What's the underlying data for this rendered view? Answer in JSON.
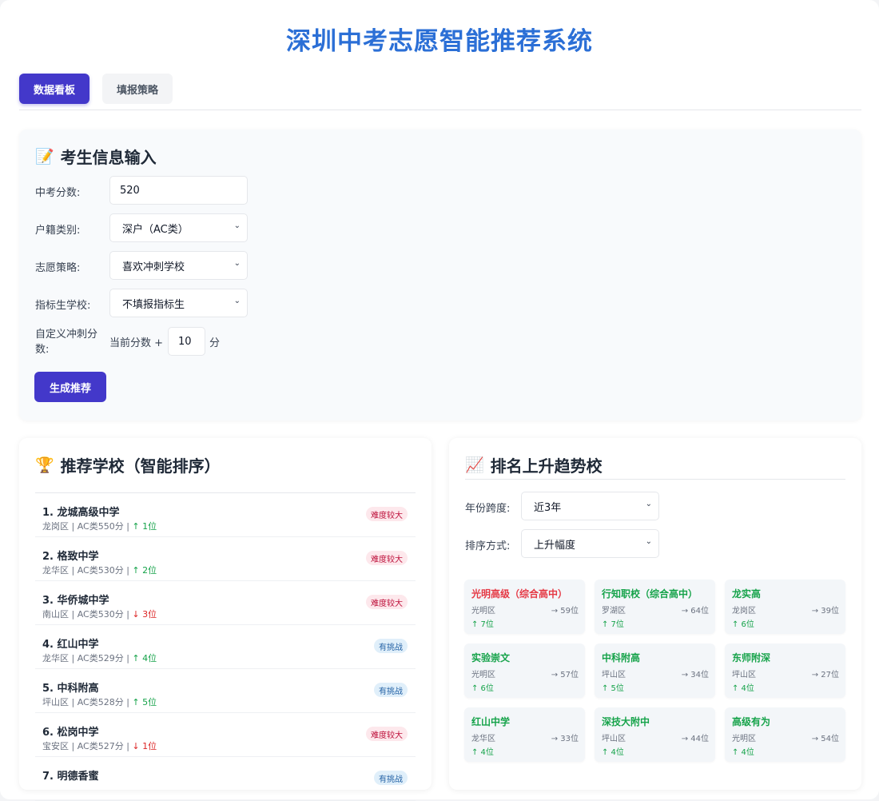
{
  "app": {
    "title": "深圳中考志愿智能推荐系统"
  },
  "tabs": [
    {
      "label": "数据看板",
      "active": true
    },
    {
      "label": "填报策略",
      "active": false
    }
  ],
  "student_form": {
    "title": "考生信息输入",
    "title_icon": "memo-icon",
    "fields": {
      "score": {
        "label": "中考分数:",
        "value": "520"
      },
      "hukou": {
        "label": "户籍类别:",
        "value": "深户（AC类）"
      },
      "strategy": {
        "label": "志愿策略:",
        "value": "喜欢冲刺学校"
      },
      "quota": {
        "label": "指标生学校:",
        "value": "不填报指标生"
      },
      "bonus": {
        "label": "自定义冲刺分数:",
        "prefix": "当前分数 +",
        "value": "10",
        "suffix": "分"
      }
    },
    "submit_label": "生成推荐"
  },
  "recommendations": {
    "title": "推荐学校（智能排序）",
    "title_icon": "trophy-icon",
    "items": [
      {
        "name": "1. 龙城高级中学",
        "meta": "龙岗区 | AC类550分 |",
        "change": "↑ 1位",
        "direction": "up",
        "badge": "难度较大",
        "badge_type": "hard"
      },
      {
        "name": "2. 格致中学",
        "meta": "龙华区 | AC类530分 |",
        "change": "↑ 2位",
        "direction": "up",
        "badge": "难度较大",
        "badge_type": "hard"
      },
      {
        "name": "3. 华侨城中学",
        "meta": "南山区 | AC类530分 |",
        "change": "↓ 3位",
        "direction": "down",
        "badge": "难度较大",
        "badge_type": "hard"
      },
      {
        "name": "4. 红山中学",
        "meta": "龙华区 | AC类529分 |",
        "change": "↑ 4位",
        "direction": "up",
        "badge": "有挑战",
        "badge_type": "chal"
      },
      {
        "name": "5. 中科附高",
        "meta": "坪山区 | AC类528分 |",
        "change": "↑ 5位",
        "direction": "up",
        "badge": "有挑战",
        "badge_type": "chal"
      },
      {
        "name": "6. 松岗中学",
        "meta": "宝安区 | AC类527分 |",
        "change": "↓ 1位",
        "direction": "down",
        "badge": "难度较大",
        "badge_type": "hard"
      },
      {
        "name": "7. 明德香蜜",
        "meta": "",
        "change": "",
        "direction": "up",
        "badge": "有挑战",
        "badge_type": "chal"
      }
    ]
  },
  "trends": {
    "title": "排名上升趋势校",
    "title_icon": "chart-up-icon",
    "year_span": {
      "label": "年份跨度:",
      "value": "近3年"
    },
    "sort_by": {
      "label": "排序方式:",
      "value": "上升幅度"
    },
    "schools": [
      {
        "name": "光明高级（综合高中）",
        "district": "光明区",
        "rank": "→ 59位",
        "change": "↑ 7位",
        "highlight": "red"
      },
      {
        "name": "行知职校（综合高中）",
        "district": "罗湖区",
        "rank": "→ 64位",
        "change": "↑ 7位",
        "highlight": "green"
      },
      {
        "name": "龙实高",
        "district": "龙岗区",
        "rank": "→ 39位",
        "change": "↑ 6位",
        "highlight": "green"
      },
      {
        "name": "实验崇文",
        "district": "光明区",
        "rank": "→ 57位",
        "change": "↑ 6位",
        "highlight": "green"
      },
      {
        "name": "中科附高",
        "district": "坪山区",
        "rank": "→ 34位",
        "change": "↑ 5位",
        "highlight": "green"
      },
      {
        "name": "东师附深",
        "district": "坪山区",
        "rank": "→ 27位",
        "change": "↑ 4位",
        "highlight": "green"
      },
      {
        "name": "红山中学",
        "district": "龙华区",
        "rank": "→ 33位",
        "change": "↑ 4位",
        "highlight": "green"
      },
      {
        "name": "深技大附中",
        "district": "坪山区",
        "rank": "→ 44位",
        "change": "↑ 4位",
        "highlight": "green"
      },
      {
        "name": "高级有为",
        "district": "光明区",
        "rank": "→ 54位",
        "change": "↑ 4位",
        "highlight": "green"
      }
    ]
  },
  "colors": {
    "primary": "#4338ca",
    "title": "#2b6fd6",
    "up": "#16a34a",
    "down": "#dc2626"
  }
}
